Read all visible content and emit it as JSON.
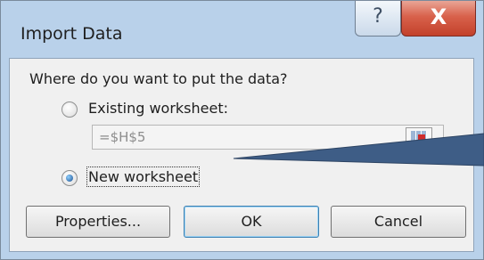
{
  "dialog": {
    "title": "Import Data",
    "help_label": "?",
    "close_label": "X",
    "question": "Where do you want to put the data?",
    "options": [
      {
        "label": "Existing worksheet:",
        "selected": false
      },
      {
        "label": "New worksheet",
        "selected": true
      }
    ],
    "reference_value": "=$H$5",
    "buttons": {
      "properties": "Properties...",
      "ok": "OK",
      "cancel": "Cancel"
    }
  },
  "colors": {
    "frame": "#b9d1ea",
    "close": "#c3412b",
    "callout_line": "#3e5d86"
  }
}
